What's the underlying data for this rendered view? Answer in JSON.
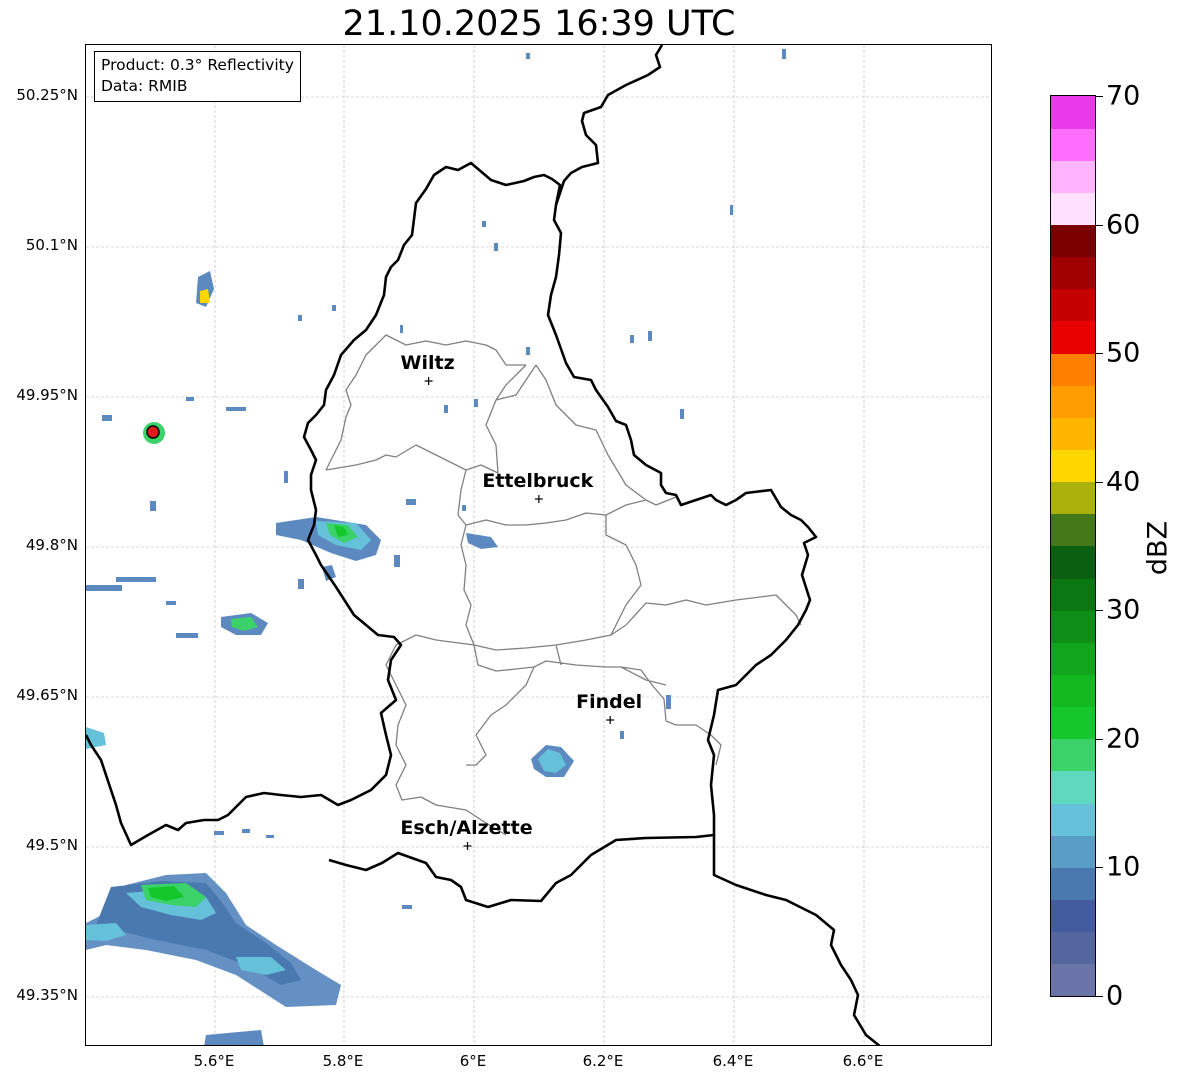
{
  "title": "21.10.2025 16:39 UTC",
  "info": {
    "product": "Product: 0.3° Reflectivity",
    "data_source": "Data: RMIB"
  },
  "axes": {
    "lat_labels": [
      "50.25°N",
      "50.1°N",
      "49.95°N",
      "49.8°N",
      "49.65°N",
      "49.5°N",
      "49.35°N"
    ],
    "lon_labels": [
      "5.6°E",
      "5.8°E",
      "6°E",
      "6.2°E",
      "6.4°E",
      "6.6°E"
    ]
  },
  "cities": [
    {
      "name": "Wiltz",
      "lon": 5.93,
      "lat": 49.965
    },
    {
      "name": "Ettelbruck",
      "lon": 6.1,
      "lat": 49.847
    },
    {
      "name": "Findel",
      "lon": 6.21,
      "lat": 49.626
    },
    {
      "name": "Esch/Alzette",
      "lon": 5.99,
      "lat": 49.5
    }
  ],
  "radar_site": {
    "lon": 5.505,
    "lat": 49.914,
    "color": "#e31a1c"
  },
  "colorbar": {
    "label": "dBZ",
    "ticks": [
      "0",
      "10",
      "20",
      "30",
      "40",
      "50",
      "60",
      "70"
    ],
    "min": 0,
    "max": 70,
    "step": 2.5,
    "colors": [
      "#6a74a8",
      "#55659e",
      "#435c9f",
      "#4a79b0",
      "#5a9ec8",
      "#65c1da",
      "#60d8c0",
      "#3cd26a",
      "#14c82c",
      "#12b91f",
      "#11a51b",
      "#0e8e17",
      "#0b7713",
      "#0b5f10",
      "#457818",
      "#aab10b",
      "#ffd700",
      "#ffb400",
      "#ff9c00",
      "#ff7f00",
      "#e60000",
      "#c40000",
      "#a00000",
      "#7a0000",
      "#ffe0ff",
      "#ffb4ff",
      "#ff6eff",
      "#e83ae8"
    ]
  }
}
